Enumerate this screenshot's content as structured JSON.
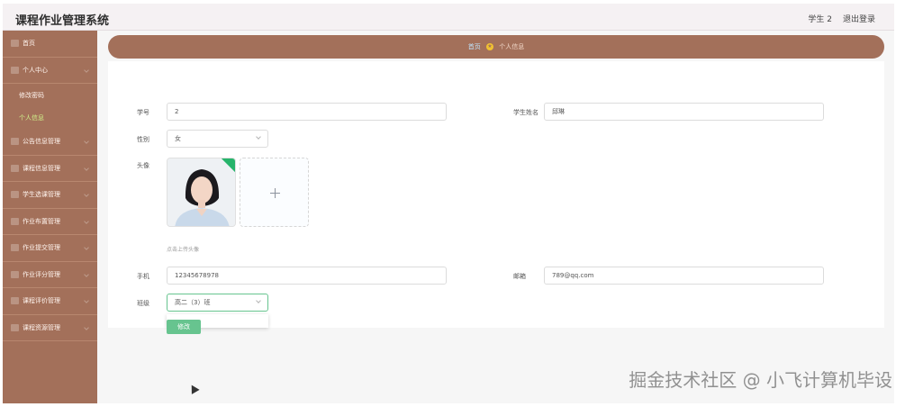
{
  "app": {
    "title": "课程作业管理系统"
  },
  "topbar": {
    "user": "学生 2",
    "logout": "退出登录"
  },
  "sidebar": {
    "items": [
      {
        "label": "首页"
      },
      {
        "label": "个人中心"
      },
      {
        "label": "修改密码"
      },
      {
        "label": "个人信息"
      },
      {
        "label": "公告信息管理"
      },
      {
        "label": "课程信息管理"
      },
      {
        "label": "学生选课管理"
      },
      {
        "label": "作业布置管理"
      },
      {
        "label": "作业提交管理"
      },
      {
        "label": "作业评分管理"
      },
      {
        "label": "课程评价管理"
      },
      {
        "label": "课程资源管理"
      }
    ]
  },
  "breadcrumb": {
    "home": "首页",
    "current": "个人信息"
  },
  "form": {
    "student_no": {
      "label": "学号",
      "value": "2"
    },
    "student_name": {
      "label": "学生姓名",
      "value": "邱琳"
    },
    "gender": {
      "label": "性别",
      "value": "女"
    },
    "avatar": {
      "label": "头像",
      "tip": "点击上传头像"
    },
    "phone": {
      "label": "手机",
      "value": "12345678978"
    },
    "email": {
      "label": "邮箱",
      "value": "789@qq.com"
    },
    "class": {
      "label": "班级",
      "value": "高二（3）班"
    },
    "modify_button": "修改"
  },
  "watermark": "掘金技术社区 @ 小飞计算机毕设",
  "colors": {
    "sidebar": "#a3705a",
    "accent": "#67c48f",
    "active_menu": "#cff08a",
    "avatar_badge": "#27b46b"
  }
}
